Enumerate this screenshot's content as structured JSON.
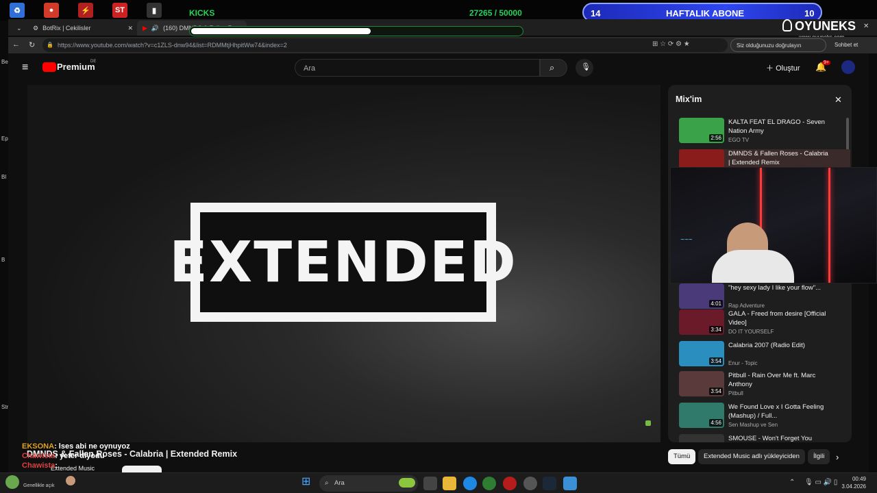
{
  "overlay": {
    "kicks_label": "KICKS",
    "kicks_count": "27265 / 50000",
    "kicks_progress": 0.545,
    "sub_left": "14",
    "sub_title": "HAFTALIK ABONE",
    "sub_right": "10",
    "brand": "OYUNEKS",
    "brand_url": "www.oyuneks.com"
  },
  "browser": {
    "tabs": [
      {
        "label": "BotRix | Cekilisler"
      },
      {
        "label": "(160) DMNDS & Fallen Roses"
      }
    ],
    "url": "https://www.youtube.com/watch?v=c1ZLS-dnw94&list=RDMMtjHhpitWw74&index=2",
    "signin_label": "Siz olduğunuzu doğrulayın",
    "chat_label": "Sohbet et"
  },
  "youtube": {
    "logo": "Premium",
    "logo_region": "DE",
    "search_placeholder": "Ara",
    "create_label": "Oluştur",
    "notif_badge": "9+",
    "video_overlay_text": "EXTENDED",
    "video_title": "DMNDS & Fallen Roses - Calabria | Extended Remix",
    "channel": "Extended Music",
    "mix_title": "Mix'im",
    "playlist": [
      {
        "title": "KALTA FEAT EL DRAGO - Seven Nation Army",
        "channel": "EGO TV",
        "duration": "2:56",
        "color": "#3aa34a"
      },
      {
        "title": "DMNDS & Fallen Roses - Calabria | Extended Remix",
        "channel": "",
        "duration": "",
        "color": "#8a1c1c"
      },
      {
        "title": "\"hey sexy lady I like your flow\"...",
        "channel": "Rap Adventure",
        "duration": "4:01",
        "color": "#4b3a7a"
      },
      {
        "title": "GALA - Freed from desire [Official Video]",
        "channel": "DO IT YOURSELF",
        "duration": "3:34",
        "color": "#6b1a2a"
      },
      {
        "title": "Calabria 2007 (Radio Edit)",
        "channel": "Enur - Topic",
        "duration": "3:54",
        "color": "#2a8fbf"
      },
      {
        "title": "Pitbull - Rain Over Me ft. Marc Anthony",
        "channel": "Pitbull",
        "duration": "3:54",
        "color": "#5a3a3a"
      },
      {
        "title": "We Found Love x I Gotta Feeling (Mashup) / Full...",
        "channel": "Sen Mashup ve Sen",
        "duration": "4:56",
        "color": "#2f7a6a"
      },
      {
        "title": "SMOUSE - Won't Forget You",
        "channel": "",
        "duration": "",
        "color": "#333333"
      }
    ],
    "chips": [
      "Tümü",
      "Extended Music adlı yükleyiciden",
      "İlgili"
    ]
  },
  "chat": [
    {
      "user": "EKSONA",
      "message": ": lses abi ne oynuyoz",
      "color": "#e0a020"
    },
    {
      "user": "Chawista",
      "message": ": yeter diyodu",
      "color": "#e04040"
    },
    {
      "user": "Chawista",
      "message": ":",
      "color": "#e04040"
    }
  ],
  "taskbar": {
    "search_placeholder": "Ara",
    "status": "Genellikle açık",
    "time": "00:49",
    "date": "3.04.2026"
  }
}
